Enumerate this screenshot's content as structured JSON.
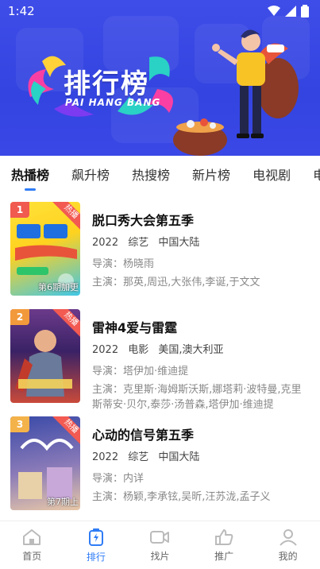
{
  "status": {
    "time": "1:42"
  },
  "banner": {
    "title": "排行榜",
    "subtitle": "PAI HANG BANG"
  },
  "tabs": [
    {
      "label": "热播榜",
      "active": true
    },
    {
      "label": "飙升榜",
      "active": false
    },
    {
      "label": "热搜榜",
      "active": false
    },
    {
      "label": "新片榜",
      "active": false
    },
    {
      "label": "电视剧",
      "active": false
    },
    {
      "label": "电影",
      "active": false
    }
  ],
  "items": [
    {
      "rank": "1",
      "rank_color": "#f05a4f",
      "ribbon": "热播",
      "episode": "第6期加更",
      "title": "脱口秀大会第五季",
      "year": "2022",
      "genre": "综艺",
      "region": "中国大陆",
      "director": "导演：杨晓雨",
      "cast": "主演：那英,周迅,大张伟,李诞,于文文"
    },
    {
      "rank": "2",
      "rank_color": "#f29a3b",
      "ribbon": "热播",
      "episode": "",
      "title": "雷神4爱与雷霆",
      "year": "2022",
      "genre": "电影",
      "region": "美国,澳大利亚",
      "director": "导演：塔伊加·维迪提",
      "cast": "主演：克里斯·海姆斯沃斯,娜塔莉·波特曼,克里斯蒂安·贝尔,泰莎·汤普森,塔伊加·维迪提"
    },
    {
      "rank": "3",
      "rank_color": "#f4b24a",
      "ribbon": "热播",
      "episode": "第7期上",
      "title": "心动的信号第五季",
      "year": "2022",
      "genre": "综艺",
      "region": "中国大陆",
      "director": "导演：内详",
      "cast": "主演：杨颖,李承铉,吴昕,汪苏泷,孟子义"
    }
  ],
  "nav": [
    {
      "label": "首页",
      "icon": "home-icon",
      "active": false
    },
    {
      "label": "排行",
      "icon": "ranking-icon",
      "active": true
    },
    {
      "label": "找片",
      "icon": "video-icon",
      "active": false
    },
    {
      "label": "推广",
      "icon": "thumbs-up-icon",
      "active": false
    },
    {
      "label": "我的",
      "icon": "user-icon",
      "active": false
    }
  ],
  "colors": {
    "accent": "#2f7cf6",
    "banner": "#3a48e6",
    "ribbon": "#f25a52"
  }
}
